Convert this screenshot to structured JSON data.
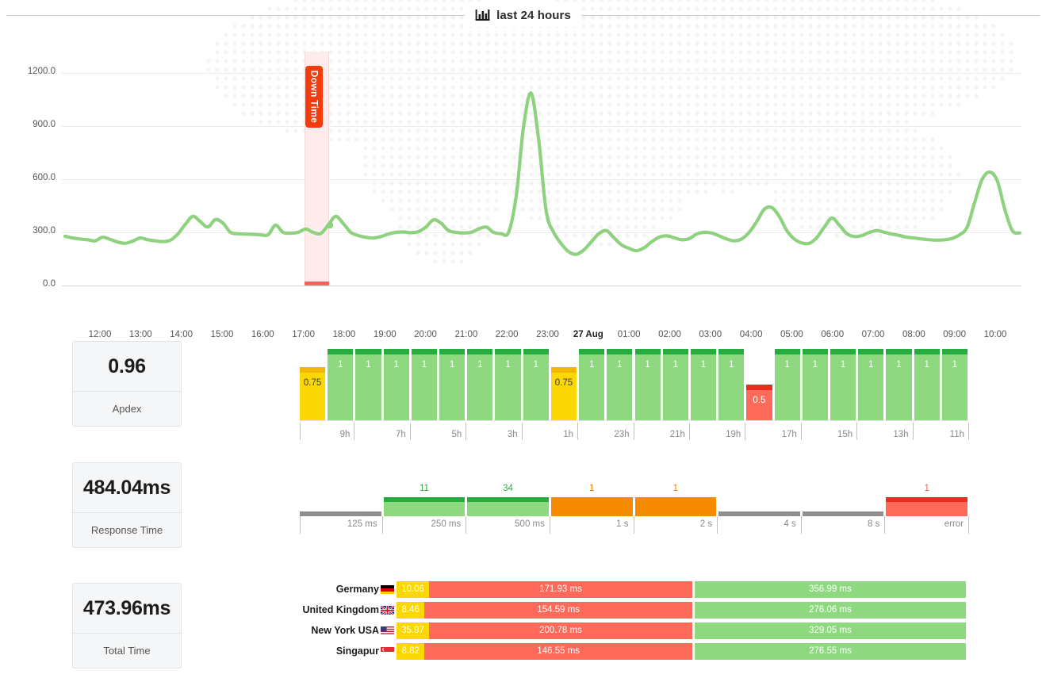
{
  "header": {
    "title": "last 24 hours",
    "icon": "bar-chart-icon"
  },
  "colors": {
    "green_line": "#8ed17f",
    "green_bar": "#8ed880",
    "green_cap": "#27ad3e",
    "yellow_bar": "#fbd706",
    "yellow_cap": "#f2b705",
    "red_bar": "#fd6a5a",
    "red_cap": "#ee2b1f",
    "orange_bar": "#f78b00",
    "grey_stub": "#8f8f8f",
    "downtime": "#f43b0c",
    "downband": "#fdeceb"
  },
  "chart_data": {
    "type": "line",
    "title": "last 24 hours",
    "xlabel": "",
    "ylabel": "",
    "ylim": [
      0,
      1320
    ],
    "yticks": [
      "0.0",
      "300.0",
      "600.0",
      "900.0",
      "1200.0"
    ],
    "ytick_values": [
      0,
      300,
      600,
      900,
      1200
    ],
    "grid": true,
    "xticks": [
      "12:00",
      "13:00",
      "14:00",
      "15:00",
      "16:00",
      "17:00",
      "18:00",
      "19:00",
      "20:00",
      "21:00",
      "22:00",
      "23:00",
      "27 Aug",
      "01:00",
      "02:00",
      "03:00",
      "04:00",
      "05:00",
      "06:00",
      "07:00",
      "08:00",
      "09:00",
      "10:00"
    ],
    "bold_xtick": "27 Aug",
    "series": [
      {
        "name": "response time",
        "color": "#8ed17f",
        "values": [
          278,
          268,
          262,
          258,
          252,
          272,
          260,
          245,
          238,
          250,
          268,
          258,
          252,
          248,
          255,
          290,
          345,
          390,
          360,
          330,
          372,
          352,
          300,
          292,
          290,
          288,
          286,
          286,
          340,
          300,
          295,
          300,
          318,
          300,
          293,
          340,
          390,
          350,
          300,
          282,
          272,
          268,
          276,
          290,
          300,
          302,
          298,
          304,
          330,
          370,
          352,
          310,
          300,
          296,
          300,
          318,
          330,
          300,
          292,
          300,
          500,
          900,
          1085,
          820,
          420,
          300,
          236,
          190,
          176,
          200,
          246,
          292,
          310,
          270,
          230,
          210,
          196,
          212,
          246,
          272,
          280,
          270,
          258,
          264,
          290,
          300,
          296,
          280,
          262,
          252,
          262,
          300,
          360,
          430,
          440,
          390,
          310,
          262,
          240,
          238,
          270,
          330,
          380,
          340,
          292,
          276,
          282,
          300,
          310,
          300,
          290,
          282,
          272,
          268,
          262,
          258,
          256,
          258,
          266,
          286,
          330,
          470,
          600,
          640,
          590,
          430,
          310,
          296
        ]
      }
    ],
    "downtime_marker": {
      "label": "Down Time",
      "start_time": "17:05",
      "end_time": "17:35"
    }
  },
  "cards": [
    {
      "value": "0.96",
      "label": "Apdex"
    },
    {
      "value": "484.04ms",
      "label": "Response Time"
    },
    {
      "value": "473.96ms",
      "label": "Total Time"
    }
  ],
  "apdex_chart": {
    "type": "bar",
    "ylim": [
      0,
      1
    ],
    "bars": [
      {
        "value": 0.75,
        "label": "0.75",
        "state": "warn"
      },
      {
        "value": 1,
        "label": "1",
        "state": "ok"
      },
      {
        "value": 1,
        "label": "1",
        "state": "ok"
      },
      {
        "value": 1,
        "label": "1",
        "state": "ok"
      },
      {
        "value": 1,
        "label": "1",
        "state": "ok"
      },
      {
        "value": 1,
        "label": "1",
        "state": "ok"
      },
      {
        "value": 1,
        "label": "1",
        "state": "ok"
      },
      {
        "value": 1,
        "label": "1",
        "state": "ok"
      },
      {
        "value": 1,
        "label": "1",
        "state": "ok"
      },
      {
        "value": 0.75,
        "label": "0.75",
        "state": "warn"
      },
      {
        "value": 1,
        "label": "1",
        "state": "ok"
      },
      {
        "value": 1,
        "label": "1",
        "state": "ok"
      },
      {
        "value": 1,
        "label": "1",
        "state": "ok"
      },
      {
        "value": 1,
        "label": "1",
        "state": "ok"
      },
      {
        "value": 1,
        "label": "1",
        "state": "ok"
      },
      {
        "value": 1,
        "label": "1",
        "state": "ok"
      },
      {
        "value": 0.5,
        "label": "0.5",
        "state": "bad"
      },
      {
        "value": 1,
        "label": "1",
        "state": "ok"
      },
      {
        "value": 1,
        "label": "1",
        "state": "ok"
      },
      {
        "value": 1,
        "label": "1",
        "state": "ok"
      },
      {
        "value": 1,
        "label": "1",
        "state": "ok"
      },
      {
        "value": 1,
        "label": "1",
        "state": "ok"
      },
      {
        "value": 1,
        "label": "1",
        "state": "ok"
      },
      {
        "value": 1,
        "label": "1",
        "state": "ok"
      }
    ],
    "tick_labels": [
      "9h",
      "7h",
      "5h",
      "3h",
      "1h",
      "23h",
      "21h",
      "19h",
      "17h",
      "15h",
      "13h",
      "11h"
    ]
  },
  "response_histogram": {
    "type": "bar",
    "buckets": [
      {
        "label": "125 ms",
        "count": null,
        "display": "",
        "state": "empty"
      },
      {
        "label": "250 ms",
        "count": 11,
        "display": "11",
        "state": "ok"
      },
      {
        "label": "500 ms",
        "count": 34,
        "display": "34",
        "state": "ok"
      },
      {
        "label": "1 s",
        "count": 1,
        "display": "1",
        "state": "warn"
      },
      {
        "label": "2 s",
        "count": 1,
        "display": "1",
        "state": "warn"
      },
      {
        "label": "4 s",
        "count": null,
        "display": "",
        "state": "empty"
      },
      {
        "label": "8 s",
        "count": null,
        "display": "",
        "state": "empty"
      },
      {
        "label": "error",
        "count": 1,
        "display": "1",
        "state": "bad"
      }
    ]
  },
  "countries": [
    {
      "name": "Germany",
      "flag": "de",
      "connect": "10.06",
      "red": "171.93 ms",
      "green": "356.99 ms"
    },
    {
      "name": "United Kingdom",
      "flag": "gb",
      "connect": "8.46",
      "red": "154.59 ms",
      "green": "276.06 ms"
    },
    {
      "name": "New York USA",
      "flag": "us",
      "connect": "35.97",
      "red": "200.78 ms",
      "green": "329.05 ms"
    },
    {
      "name": "Singapur",
      "flag": "sg",
      "connect": "8.82",
      "red": "146.55 ms",
      "green": "276.55 ms"
    }
  ]
}
